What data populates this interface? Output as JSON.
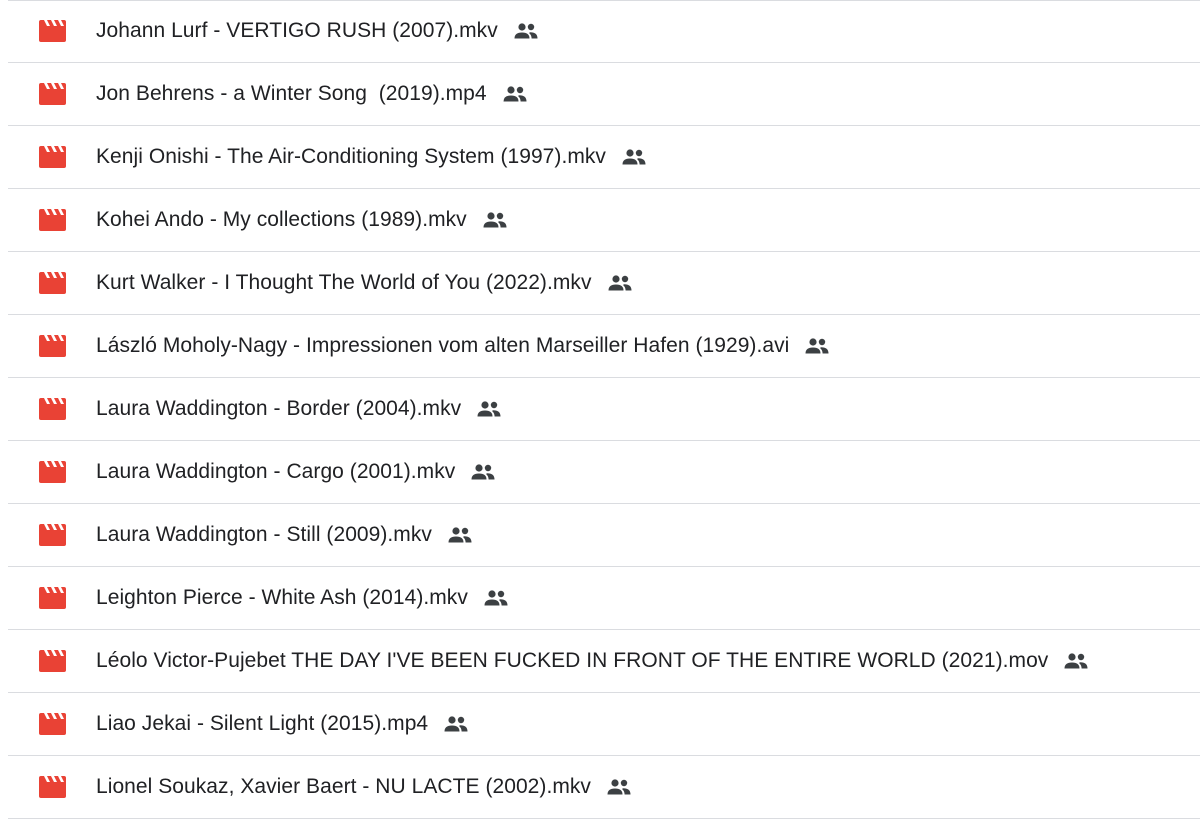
{
  "colors": {
    "video_icon": "#e94235",
    "shared_icon": "#3c4043",
    "text": "#202124",
    "divider": "#dadce0"
  },
  "files": [
    {
      "name": "Johann Lurf - VERTIGO RUSH (2007).mkv",
      "icon": "video-file-icon",
      "shared": true
    },
    {
      "name": "Jon Behrens - a Winter Song  (2019).mp4",
      "icon": "video-file-icon",
      "shared": true
    },
    {
      "name": "Kenji Onishi - The Air-Conditioning System (1997).mkv",
      "icon": "video-file-icon",
      "shared": true
    },
    {
      "name": "Kohei Ando - My collections (1989).mkv",
      "icon": "video-file-icon",
      "shared": true
    },
    {
      "name": "Kurt Walker - I Thought The World of You (2022).mkv",
      "icon": "video-file-icon",
      "shared": true
    },
    {
      "name": "László Moholy-Nagy - Impressionen vom alten Marseiller Hafen (1929).avi",
      "icon": "video-file-icon",
      "shared": true
    },
    {
      "name": "Laura Waddington - Border (2004).mkv",
      "icon": "video-file-icon",
      "shared": true
    },
    {
      "name": "Laura Waddington - Cargo (2001).mkv",
      "icon": "video-file-icon",
      "shared": true
    },
    {
      "name": "Laura Waddington - Still (2009).mkv",
      "icon": "video-file-icon",
      "shared": true
    },
    {
      "name": "Leighton Pierce - White Ash (2014).mkv",
      "icon": "video-file-icon",
      "shared": true
    },
    {
      "name": "Léolo Victor-Pujebet THE DAY I'VE BEEN FUCKED IN FRONT OF THE ENTIRE WORLD (2021).mov",
      "icon": "video-file-icon",
      "shared": true
    },
    {
      "name": "Liao Jekai - Silent Light (2015).mp4",
      "icon": "video-file-icon",
      "shared": true
    },
    {
      "name": "Lionel Soukaz, Xavier Baert - NU LACTE (2002).mkv",
      "icon": "video-file-icon",
      "shared": true
    }
  ]
}
